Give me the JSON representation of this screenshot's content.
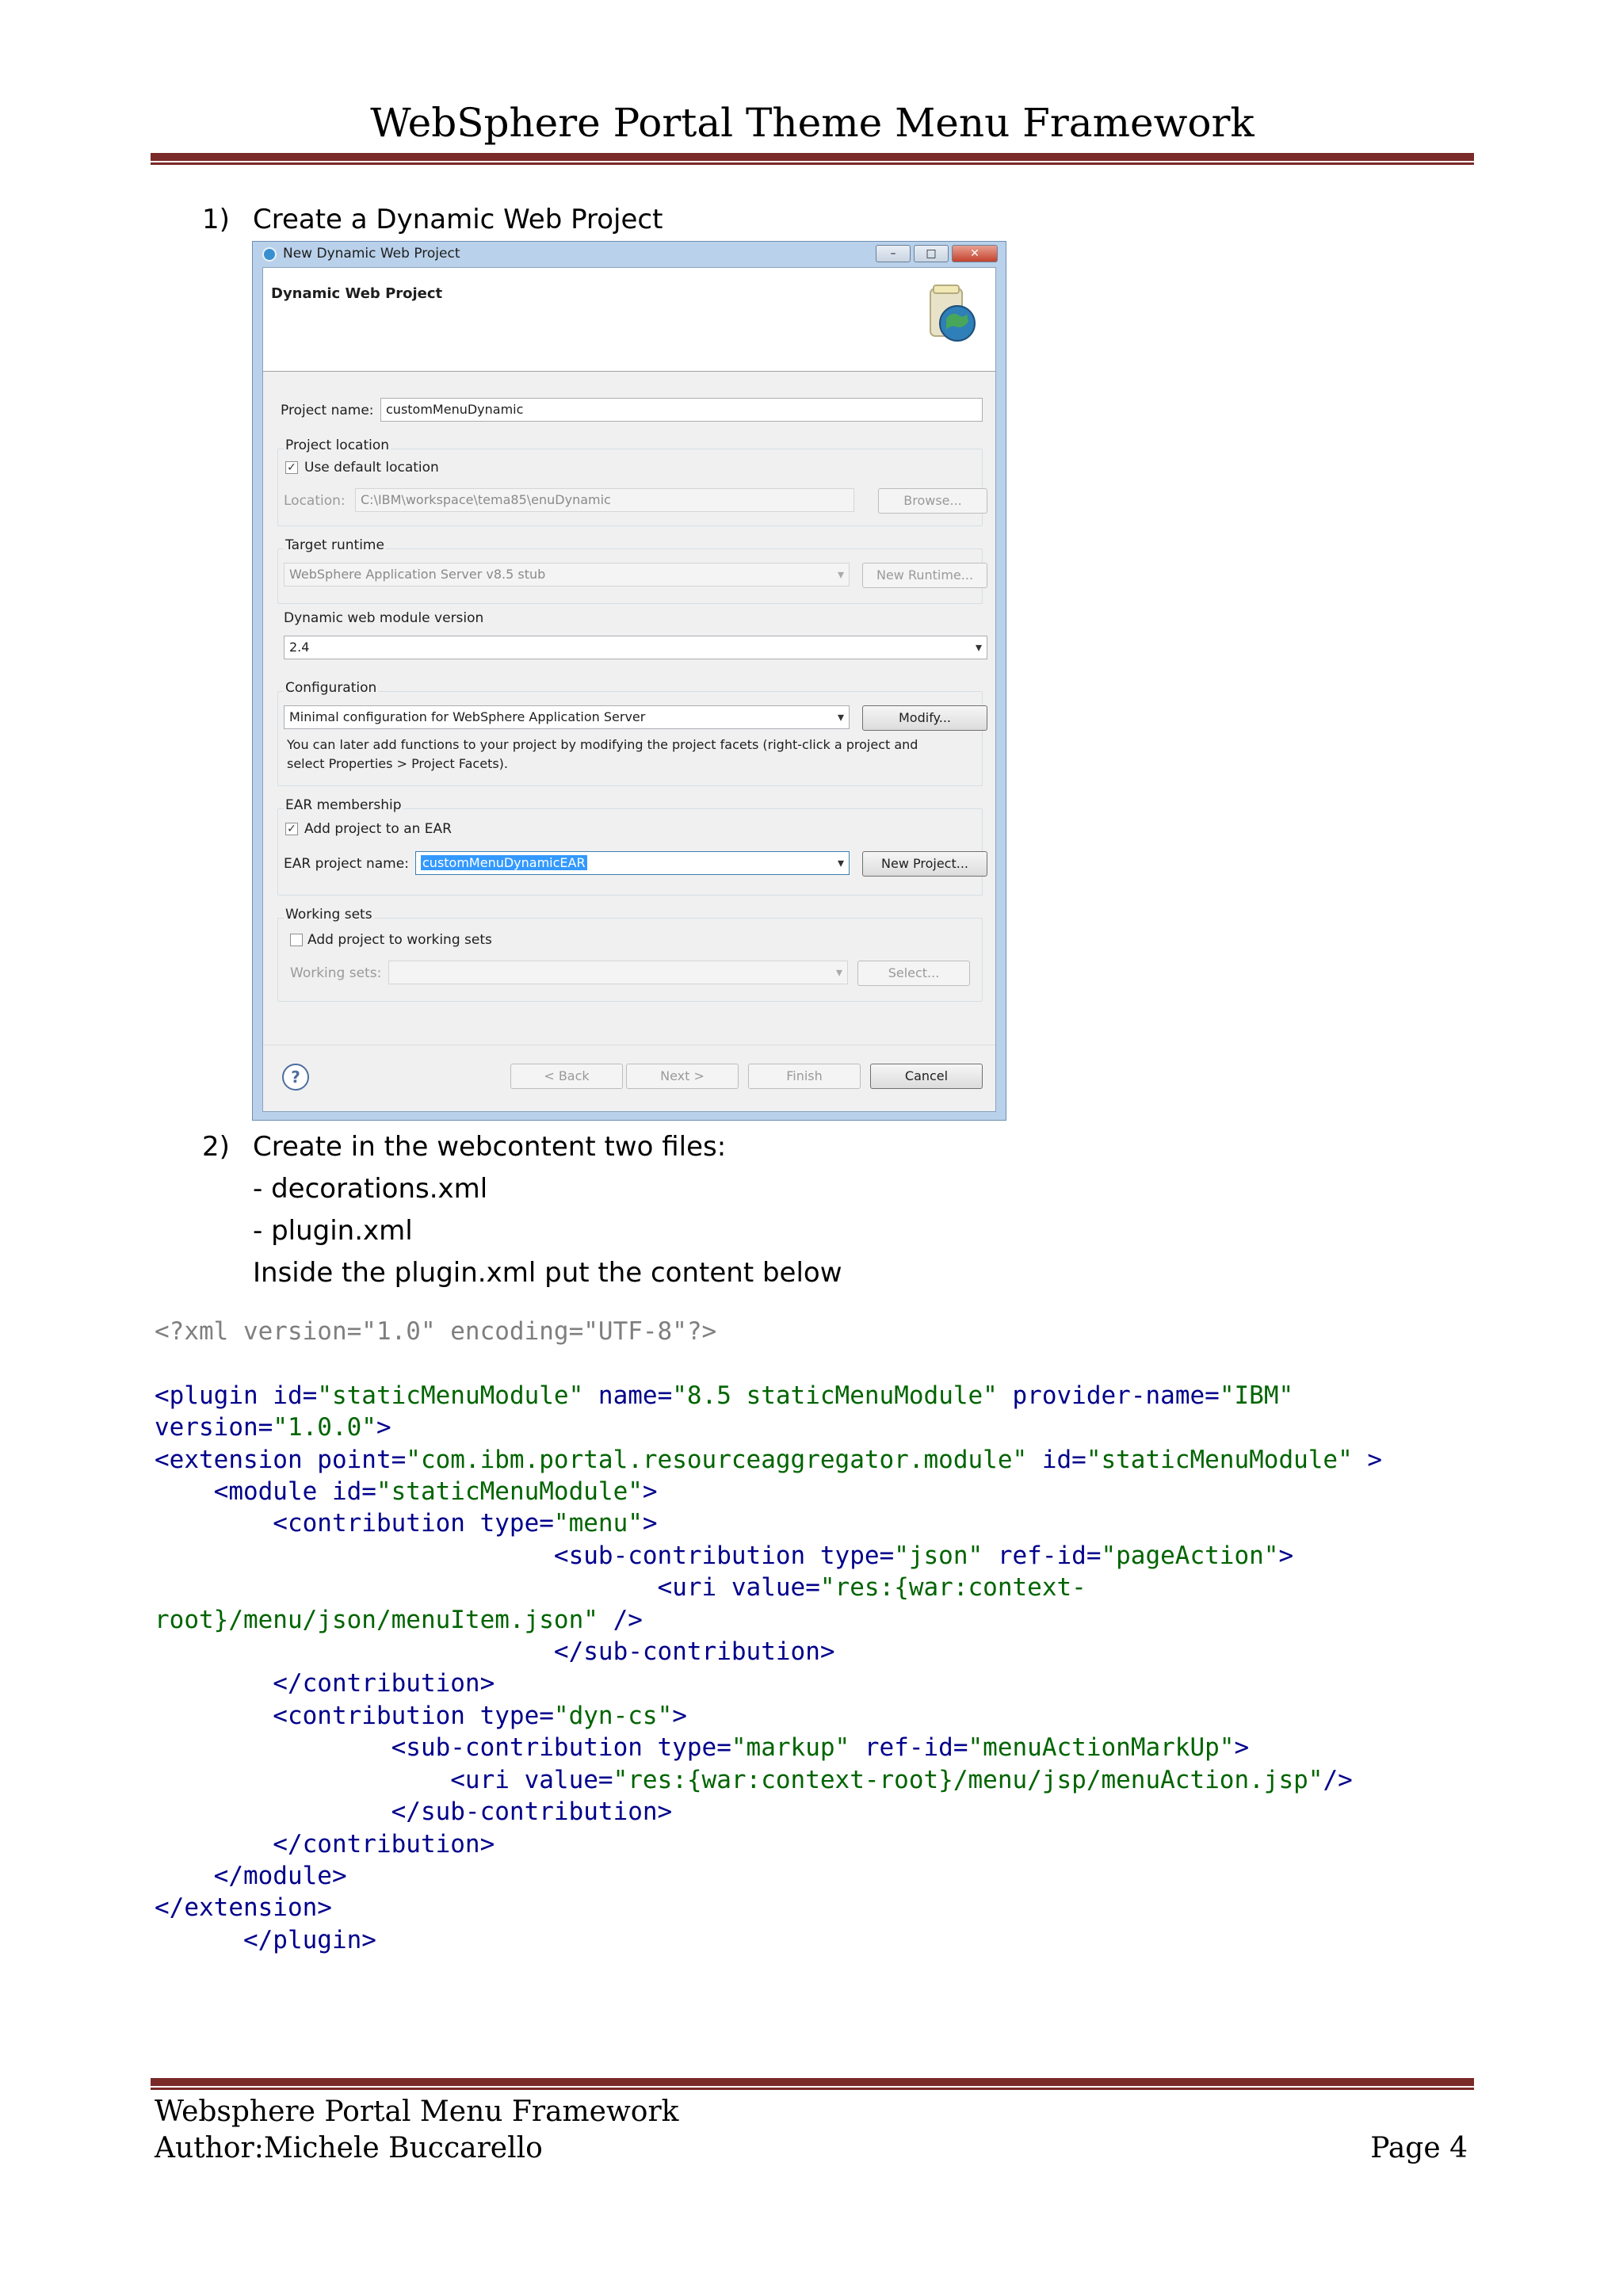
{
  "header": {
    "title": "WebSphere Portal Theme Menu Framework"
  },
  "steps": [
    {
      "number": "1)",
      "text": "Create a Dynamic Web Project"
    },
    {
      "number": "2)",
      "text": "Create in the webcontent two files:",
      "lines": [
        "- decorations.xml",
        "- plugin.xml",
        "Inside the plugin.xml put the content below"
      ]
    }
  ],
  "dialog": {
    "window_title": "New Dynamic Web Project",
    "banner_title": "Dynamic Web Project",
    "project_name_label": "Project name:",
    "project_name_value": "customMenuDynamic",
    "project_location_label": "Project location",
    "use_default_location_label": "Use default location",
    "use_default_location_checked": true,
    "location_label": "Location:",
    "location_value": "C:\\IBM\\workspace\\tema85\\enuDynamic",
    "browse_button": "Browse...",
    "target_runtime_label": "Target runtime",
    "target_runtime_value": "WebSphere Application Server v8.5 stub",
    "new_runtime_button": "New Runtime...",
    "module_version_label": "Dynamic web module version",
    "module_version_value": "2.4",
    "configuration_label": "Configuration",
    "configuration_value": "Minimal configuration for WebSphere Application Server",
    "modify_button": "Modify...",
    "configuration_help_1": "You can later add functions to your project by modifying the project facets (right-click a project and",
    "configuration_help_2": "select Properties > Project Facets).",
    "ear_membership_label": "EAR membership",
    "add_to_ear_label": "Add project to an EAR",
    "add_to_ear_checked": true,
    "ear_project_name_label": "EAR project name:",
    "ear_project_name_value": "customMenuDynamicEAR",
    "new_project_button": "New Project...",
    "working_sets_label": "Working sets",
    "add_to_working_sets_label": "Add project to working sets",
    "add_to_working_sets_checked": false,
    "working_sets_field_label": "Working sets:",
    "select_button": "Select...",
    "help_glyph": "?",
    "back_button": "< Back",
    "next_button": "Next >",
    "finish_button": "Finish",
    "cancel_button": "Cancel"
  },
  "code": {
    "line_01": "<?xml version=\"1.0\" encoding=\"UTF-8\"?>",
    "line_02": "",
    "line_03a": "<plugin id=",
    "line_03b": "\"staticMenuModule\"",
    "line_03c": " name=",
    "line_03d": "\"8.5 staticMenuModule\"",
    "line_03e": " provider-name=",
    "line_03f": "\"IBM\"",
    "line_04a": "version=",
    "line_04b": "\"1.0.0\"",
    "line_04c": ">",
    "line_05a": "<extension point=",
    "line_05b": "\"com.ibm.portal.resourceaggregator.module\"",
    "line_05c": " id=",
    "line_05d": "\"staticMenuModule\"",
    "line_05e": " >",
    "line_06a": "    <module id=",
    "line_06b": "\"staticMenuModule\"",
    "line_06c": ">",
    "line_07a": "        <contribution type=",
    "line_07b": "\"menu\"",
    "line_07c": ">",
    "line_08a": "                           <sub-contribution type=",
    "line_08b": "\"json\"",
    "line_08c": " ref-id=",
    "line_08d": "\"pageAction\"",
    "line_08e": ">",
    "line_09a": "                                  <uri value=",
    "line_09b": "\"res:{war:context-",
    "line_10a": "root}/menu/json/menuItem.json\"",
    "line_10b": " />",
    "line_11": "                           </sub-contribution>",
    "line_12": "        </contribution>",
    "line_13a": "        <contribution type=",
    "line_13b": "\"dyn-cs\"",
    "line_13c": ">",
    "line_14a": "                <sub-contribution type=",
    "line_14b": "\"markup\"",
    "line_14c": " ref-id=",
    "line_14d": "\"menuActionMarkUp\"",
    "line_14e": ">",
    "line_15a": "                    <uri value=",
    "line_15b": "\"res:{war:context-root}/menu/jsp/menuAction.jsp\"",
    "line_15c": "/>",
    "line_16": "                </sub-contribution>",
    "line_17": "        </contribution>",
    "line_18": "    </module>",
    "line_19": "</extension>",
    "line_20": "      </plugin>"
  },
  "footer": {
    "line1": "Websphere Portal Menu Framework",
    "line2": "Author:Michele Buccarello",
    "page": "Page 4"
  },
  "colors": {
    "rule": "#7a2a28",
    "code_tag": "#00008b",
    "code_value": "#006400",
    "code_decl": "#7f7f7f",
    "selection": "#3399ff"
  }
}
